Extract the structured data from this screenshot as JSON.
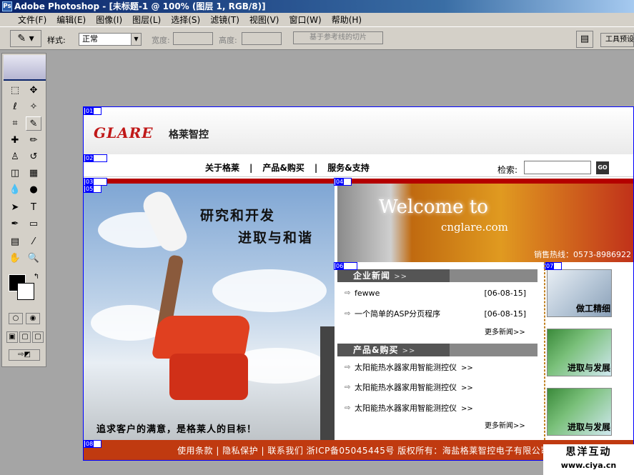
{
  "app": {
    "title": "Adobe Photoshop - [未标题-1 @ 100% (图层 1, RGB/8)]",
    "icon": "photoshop-icon"
  },
  "menu": [
    "文件(F)",
    "编辑(E)",
    "图像(I)",
    "图层(L)",
    "选择(S)",
    "滤镜(T)",
    "视图(V)",
    "窗口(W)",
    "帮助(H)"
  ],
  "options": {
    "style_label": "样式:",
    "style_value": "正常",
    "width_label": "宽度:",
    "height_label": "高度:",
    "slice_btn": "基于参考线的切片",
    "toolbar_tab": "工具预设"
  },
  "slices": [
    "01",
    "02",
    "03",
    "04",
    "05",
    "06",
    "07",
    "08"
  ],
  "site": {
    "logo_en": "GLARE",
    "logo_cn": "格莱智控",
    "nav": [
      "关于格莱",
      "产品&购买",
      "服务&支持"
    ],
    "nav_sep": "|",
    "search_label": "检索:",
    "search_go": "GO",
    "hero_line1": "研究和开发",
    "hero_line2": "进取与和谐",
    "hero_slogan": "追求客户的满意，是格莱人的目标！",
    "welcome_1": "Welcome to",
    "welcome_2": "cnglare.com",
    "hotline": "销售热线：0573-8986922",
    "news_title": "企业新闻",
    "news": [
      {
        "title": "fewwe",
        "date": "[06-08-15]"
      },
      {
        "title": "一个简单的ASP分页程序",
        "date": "[06-08-15]"
      }
    ],
    "more": "更多新闻",
    "more_arrow": ">>",
    "title_arrow": ">>",
    "product_title": "产品&购买",
    "products": [
      "太阳能热水器家用智能测控仪",
      "太阳能热水器家用智能测控仪",
      "太阳能热水器家用智能测控仪"
    ],
    "product_arrow": ">>",
    "thumbs": [
      "做工精细",
      "进取与发展",
      "进取与发展"
    ],
    "footer": "使用条款 | 隐私保护 | 联系我们  浙ICP备05045445号  版权所有：海盐格莱智控电子有限公司"
  },
  "watermark": {
    "line1": "思洋互动",
    "line2": "www.ciya.cn"
  }
}
